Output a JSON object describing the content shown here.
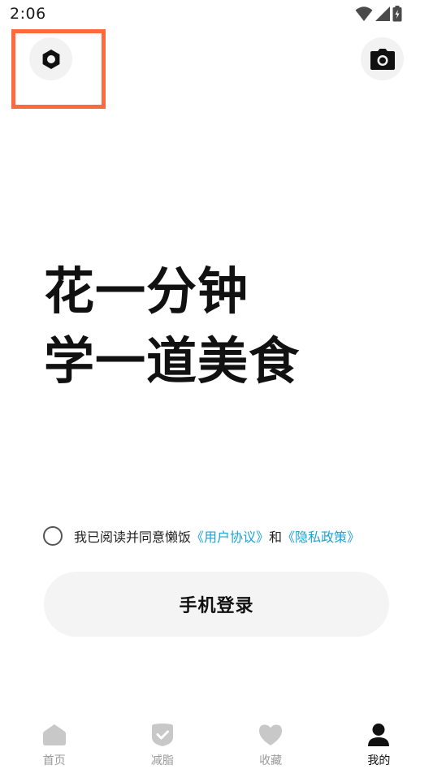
{
  "status_bar": {
    "time": "2:06",
    "icons": [
      "wifi-icon",
      "signal-icon",
      "battery-charging-icon"
    ]
  },
  "header": {
    "settings_icon": "hexagon-settings-icon",
    "camera_icon": "camera-icon"
  },
  "slogan": {
    "line1": "花一分钟",
    "line2": "学一道美食"
  },
  "agreement": {
    "prefix": "我已阅读并同意懒饭",
    "user_agreement": "《用户协议》",
    "and": "和",
    "privacy_policy": "《隐私政策》",
    "checked": false
  },
  "login": {
    "label": "手机登录"
  },
  "nav": {
    "items": [
      {
        "label": "首页",
        "icon": "home-icon",
        "active": false
      },
      {
        "label": "减脂",
        "icon": "shield-check-icon",
        "active": false
      },
      {
        "label": "收藏",
        "icon": "heart-icon",
        "active": false
      },
      {
        "label": "我的",
        "icon": "person-icon",
        "active": true
      }
    ]
  },
  "colors": {
    "link": "#1aa3d6",
    "highlight": "#ff6a3d",
    "button_bg": "#f4f4f4",
    "inactive_nav": "#c8c8c8",
    "active_nav": "#111111"
  }
}
